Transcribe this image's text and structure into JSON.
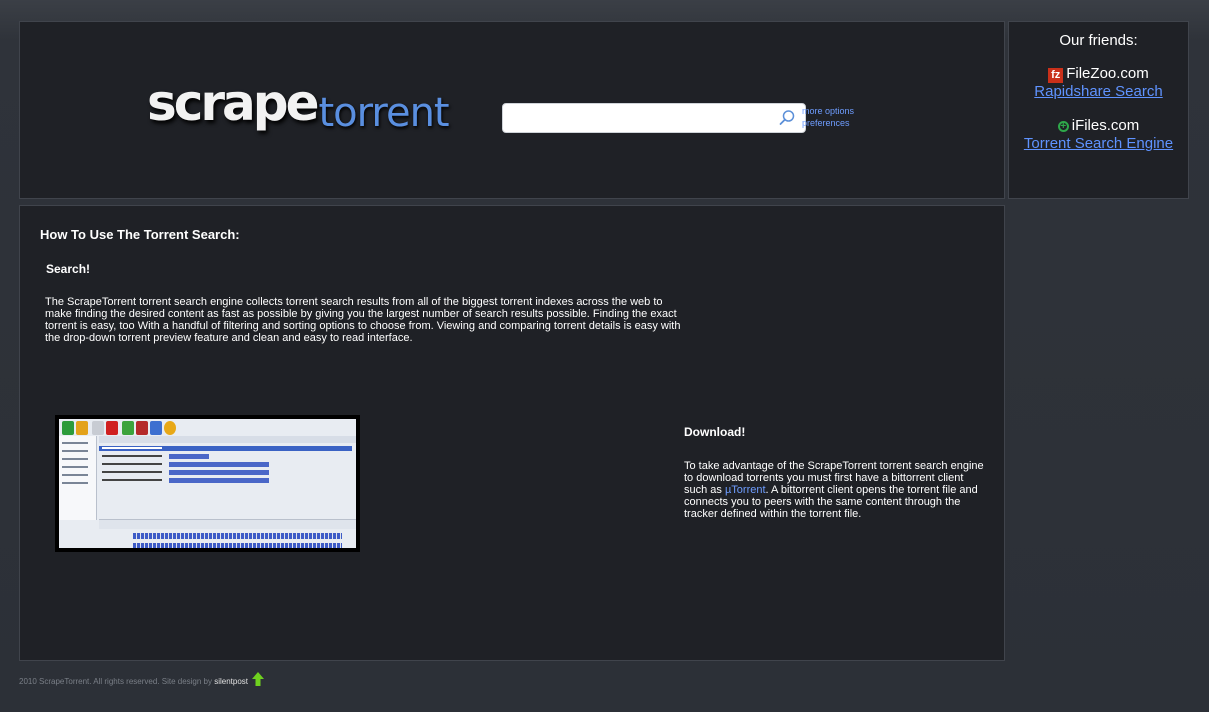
{
  "header": {
    "logo_part1": "scrape",
    "logo_part2": "torrent",
    "search_placeholder": "",
    "links": {
      "more_options": "more options",
      "preferences": "preferences"
    }
  },
  "friends": {
    "title": "Our friends:",
    "items": [
      {
        "icon": "fz",
        "name": "FileZoo.com",
        "link": "Rapidshare Search"
      },
      {
        "icon": "iFiles",
        "name": "iFiles.com",
        "link": "Torrent Search Engine"
      }
    ]
  },
  "main": {
    "howto_title": "How To Use The Torrent Search:",
    "search_title": "Search!",
    "search_text": "The ScrapeTorrent torrent search engine collects torrent search results from all of the biggest torrent indexes across the web to make finding the desired content as fast as possible by giving you the largest number of search results possible. Finding the exact torrent is easy, too With a handful of filtering and sorting options to choose from. Viewing and comparing torrent details is easy with the drop-down torrent preview feature and clean and easy to read interface.",
    "download_title": "Download!",
    "download_text_before": "To take advantage of the ScrapeTorrent torrent search engine to download torrents you must first have a bittorrent client such as ",
    "download_link": "µTorrent",
    "download_text_after": ". A bittorrent client opens the torrent file and connects you to peers with the same content through the tracker defined within the torrent file."
  },
  "footer": {
    "text": "2010 ScrapeTorrent. All rights reserved. Site design by ",
    "credit": "silentpost"
  },
  "colors": {
    "accent": "#5a8fe0",
    "link": "#6e9dff",
    "panel_bg": "#1f2126",
    "page_bg": "#2c3037"
  }
}
